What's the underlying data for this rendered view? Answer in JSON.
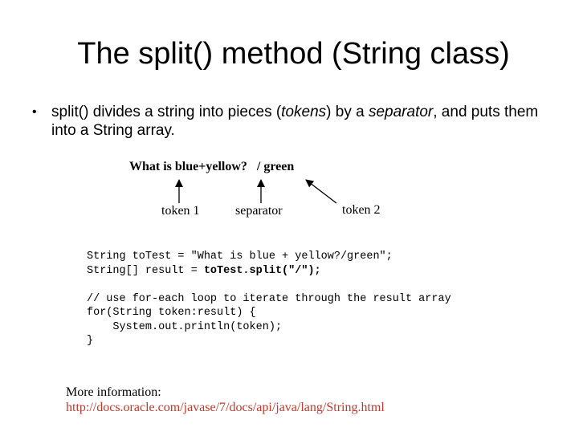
{
  "slide": {
    "title": "The split() method (String class)",
    "bullet": {
      "marker": "•",
      "part1": "split() divides a string into pieces (",
      "em1": "tokens",
      "part2": ") by a ",
      "em2": "separator",
      "part3": ", and puts them into a String array."
    },
    "diagram": {
      "sentence": "What is blue+yellow?   / green",
      "labels": {
        "token1": "token 1",
        "separator": "separator",
        "token2": "token 2"
      }
    },
    "code": {
      "line1": "String toTest = \"What is blue + yellow?/green\";",
      "line2_prefix": "String[] result = ",
      "line2_bold": "toTest.split(\"/\");",
      "line3": "",
      "line4": "// use for-each loop to iterate through the result array",
      "line5": "for(String token:result) {",
      "line6": "    System.out.println(token);",
      "line7": "}"
    },
    "more_info": {
      "label": "More information:",
      "url": "http://docs.oracle.com/javase/7/docs/api/java/lang/String.html"
    }
  }
}
